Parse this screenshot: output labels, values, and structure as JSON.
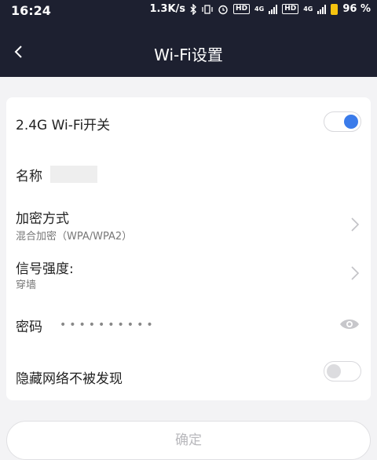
{
  "status_bar": {
    "time": "16:24",
    "speed": "1.3K/s",
    "network1": "4G",
    "network2": "4G",
    "hd_badge": "HD",
    "battery": "96 %"
  },
  "header": {
    "title": "Wi-Fi设置"
  },
  "settings": {
    "wifi_toggle_label": "2.4G Wi-Fi开关",
    "wifi_enabled": true,
    "name_label": "名称",
    "encryption_label": "加密方式",
    "encryption_value": "混合加密（WPA/WPA2）",
    "signal_label": "信号强度:",
    "signal_value": "穿墙",
    "password_label": "密码",
    "password_mask": "••••••••••",
    "hide_network_label": "隐藏网络不被发现",
    "hide_network_enabled": false
  },
  "actions": {
    "confirm_label": "确定"
  },
  "colors": {
    "header_bg": "#1d2030",
    "accent": "#3a7bea",
    "battery": "#f6c40f"
  }
}
